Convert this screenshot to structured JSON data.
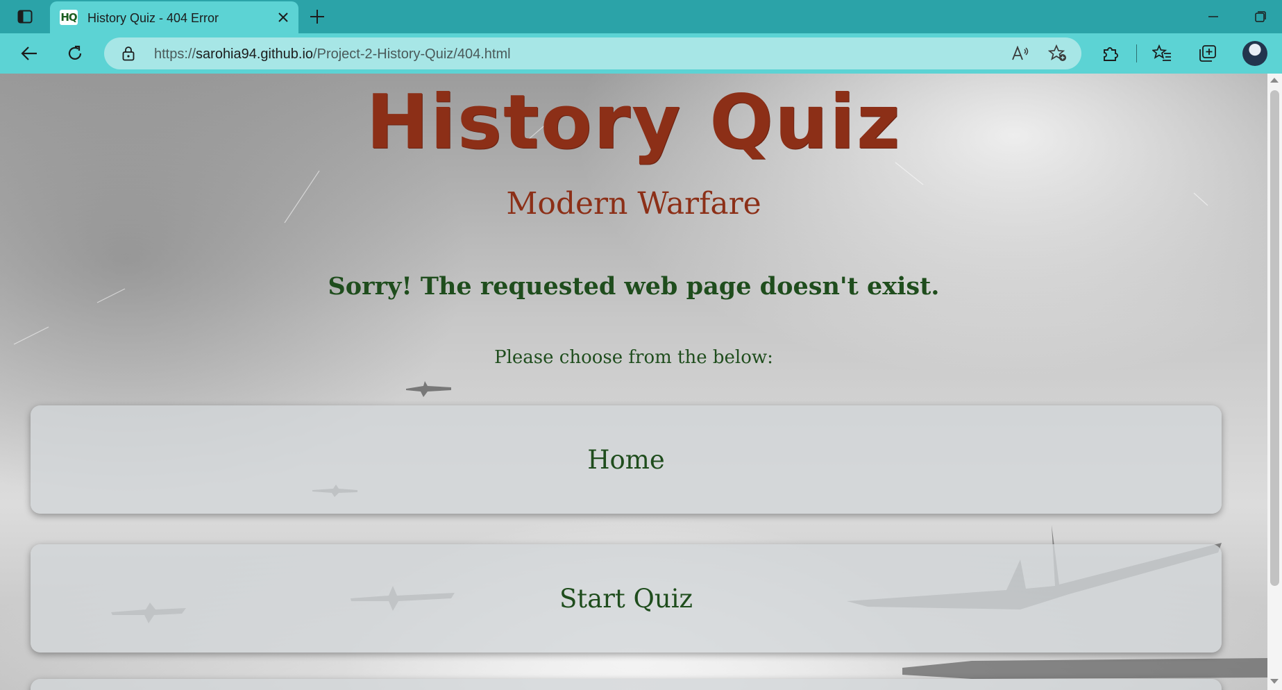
{
  "browser": {
    "tab": {
      "favicon_text": "HQ",
      "title": "History Quiz - 404 Error"
    },
    "address": {
      "scheme": "https://",
      "host": "sarohia94.github.io",
      "path": "/Project-2-History-Quiz/404.html"
    },
    "icons": {
      "tab_actions": "tab-actions-icon",
      "close": "close-icon",
      "new_tab": "plus-icon",
      "back": "back-arrow-icon",
      "refresh": "refresh-icon",
      "lock": "lock-icon",
      "read_aloud": "read-aloud-icon",
      "add_favorite": "star-plus-icon",
      "extensions": "puzzle-icon",
      "favorites": "favorites-list-icon",
      "collections": "collections-icon",
      "profile": "avatar",
      "minimize": "minimize-icon",
      "maximize": "maximize-icon"
    },
    "colors": {
      "tabbar": "#2ba3a8",
      "toolbar": "#5cd3d4",
      "address_bg": "#a7e6e6"
    }
  },
  "page": {
    "site_title": "History Quiz",
    "subtitle": "Modern Warfare",
    "error_message": "Sorry! The requested web page doesn't exist.",
    "instruction": "Please choose from the below:",
    "buttons": [
      {
        "label": "Home"
      },
      {
        "label": "Start Quiz"
      }
    ],
    "colors": {
      "title": "#8c2f17",
      "text_green": "#1f4d1d"
    }
  }
}
